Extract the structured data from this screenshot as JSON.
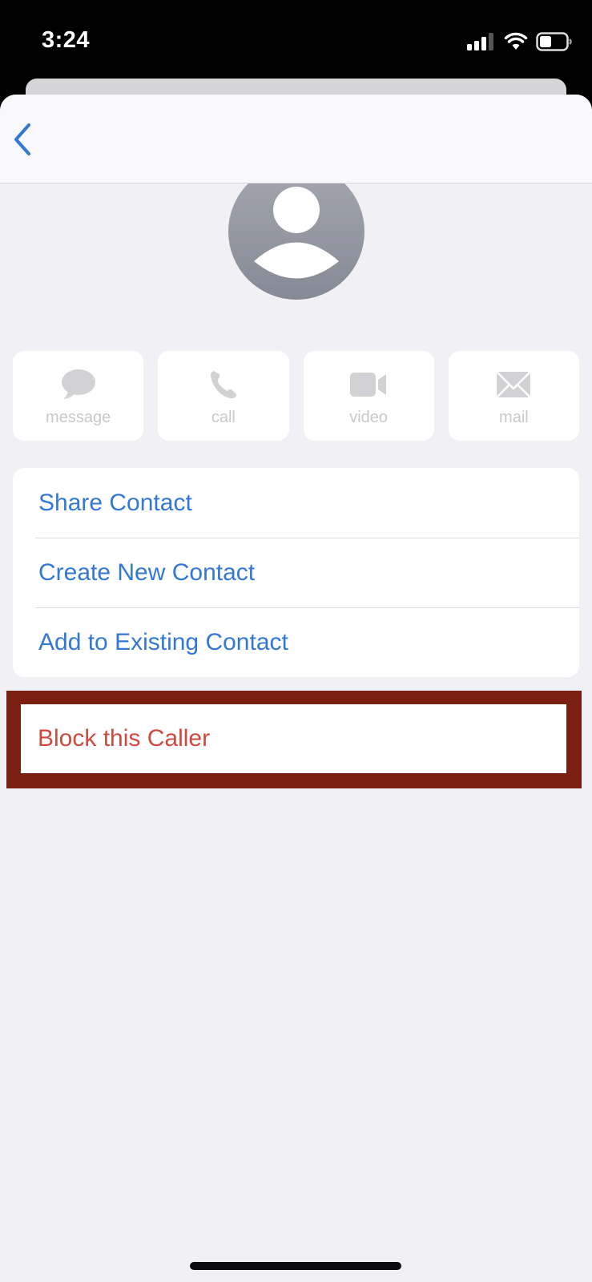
{
  "status_bar": {
    "time": "3:24",
    "icons": [
      "cellular-signal-icon",
      "wifi-icon",
      "battery-icon"
    ]
  },
  "nav": {
    "back_icon": "chevron-left-icon"
  },
  "contact": {
    "avatar_icon": "person-silhouette-icon"
  },
  "actions": [
    {
      "label": "message",
      "icon": "message-bubble-icon"
    },
    {
      "label": "call",
      "icon": "phone-icon"
    },
    {
      "label": "video",
      "icon": "video-camera-icon"
    },
    {
      "label": "mail",
      "icon": "envelope-icon"
    }
  ],
  "options": [
    {
      "label": "Share Contact"
    },
    {
      "label": "Create New Contact"
    },
    {
      "label": "Add to Existing Contact"
    }
  ],
  "block": {
    "label": "Block this Caller"
  },
  "colors": {
    "accent": "#3478d6",
    "destructive": "#cf4a3e",
    "highlight_frame": "#7a1f12",
    "background": "#f0f0f5"
  }
}
